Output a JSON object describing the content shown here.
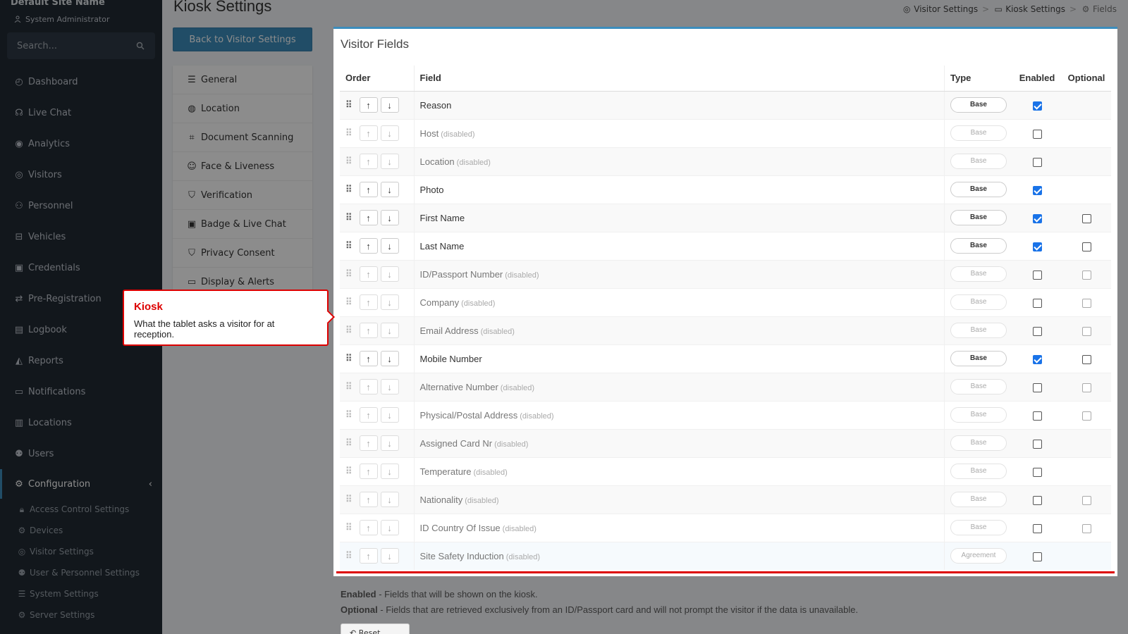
{
  "sidebar": {
    "site_name": "Default Site Name",
    "user_role": "System Administrator",
    "search_placeholder": "Search...",
    "items": [
      {
        "label": "Dashboard",
        "icon": "dashboard-icon"
      },
      {
        "label": "Live Chat",
        "icon": "headset-icon"
      },
      {
        "label": "Analytics",
        "icon": "analytics-icon"
      },
      {
        "label": "Visitors",
        "icon": "eye-icon"
      },
      {
        "label": "Personnel",
        "icon": "personnel-icon"
      },
      {
        "label": "Vehicles",
        "icon": "car-icon"
      },
      {
        "label": "Credentials",
        "icon": "badge-icon"
      },
      {
        "label": "Pre-Registration",
        "icon": "arrows-icon"
      },
      {
        "label": "Logbook",
        "icon": "book-icon"
      },
      {
        "label": "Reports",
        "icon": "reports-icon"
      },
      {
        "label": "Notifications",
        "icon": "chat-icon"
      },
      {
        "label": "Locations",
        "icon": "building-icon"
      },
      {
        "label": "Users",
        "icon": "users-icon"
      }
    ],
    "active_item": {
      "label": "Configuration",
      "icon": "gear-icon"
    },
    "sub_items": [
      {
        "label": "Access Control Settings",
        "icon": "lock-icon"
      },
      {
        "label": "Devices",
        "icon": "gear-icon"
      },
      {
        "label": "Visitor Settings",
        "icon": "eye-icon"
      },
      {
        "label": "User & Personnel Settings",
        "icon": "users-icon"
      },
      {
        "label": "System Settings",
        "icon": "sliders-icon"
      },
      {
        "label": "Server Settings",
        "icon": "server-icon"
      }
    ]
  },
  "header": {
    "title": "Kiosk Settings",
    "breadcrumb": [
      "Visitor Settings",
      "Kiosk Settings",
      "Fields"
    ]
  },
  "back_button": "Back to Visitor Settings",
  "settings_menu": [
    "General",
    "Location",
    "Document Scanning",
    "Face & Liveness",
    "Verification",
    "Badge & Live Chat",
    "Privacy Consent",
    "Display & Alerts"
  ],
  "panel": {
    "title": "Visitor Fields",
    "columns": {
      "order": "Order",
      "field": "Field",
      "type": "Type",
      "enabled": "Enabled",
      "optional": "Optional"
    },
    "disabled_note": "(disabled)",
    "rows": [
      {
        "field": "Reason",
        "disabled": false,
        "type": "Base",
        "enabled": true,
        "optional": null
      },
      {
        "field": "Host",
        "disabled": true,
        "type": "Base",
        "enabled": false,
        "optional": null
      },
      {
        "field": "Location",
        "disabled": true,
        "type": "Base",
        "enabled": false,
        "optional": null
      },
      {
        "field": "Photo",
        "disabled": false,
        "type": "Base",
        "enabled": true,
        "optional": null
      },
      {
        "field": "First Name",
        "disabled": false,
        "type": "Base",
        "enabled": true,
        "optional": false
      },
      {
        "field": "Last Name",
        "disabled": false,
        "type": "Base",
        "enabled": true,
        "optional": false
      },
      {
        "field": "ID/Passport Number",
        "disabled": true,
        "type": "Base",
        "enabled": false,
        "optional": false
      },
      {
        "field": "Company",
        "disabled": true,
        "type": "Base",
        "enabled": false,
        "optional": false
      },
      {
        "field": "Email Address",
        "disabled": true,
        "type": "Base",
        "enabled": false,
        "optional": false
      },
      {
        "field": "Mobile Number",
        "disabled": false,
        "type": "Base",
        "enabled": true,
        "optional": false
      },
      {
        "field": "Alternative Number",
        "disabled": true,
        "type": "Base",
        "enabled": false,
        "optional": false
      },
      {
        "field": "Physical/Postal Address",
        "disabled": true,
        "type": "Base",
        "enabled": false,
        "optional": false
      },
      {
        "field": "Assigned Card Nr",
        "disabled": true,
        "type": "Base",
        "enabled": false,
        "optional": null
      },
      {
        "field": "Temperature",
        "disabled": true,
        "type": "Base",
        "enabled": false,
        "optional": null
      },
      {
        "field": "Nationality",
        "disabled": true,
        "type": "Base",
        "enabled": false,
        "optional": false
      },
      {
        "field": "ID Country Of Issue",
        "disabled": true,
        "type": "Base",
        "enabled": false,
        "optional": false
      },
      {
        "field": "Site Safety Induction",
        "disabled": true,
        "type": "Agreement",
        "enabled": false,
        "optional": null
      }
    ]
  },
  "legend": {
    "enabled_label": "Enabled",
    "enabled_text": " - Fields that will be shown on the kiosk.",
    "optional_label": "Optional",
    "optional_text": " - Fields that are retrieved exclusively from an ID/Passport card and will not prompt the visitor if the data is unavailable."
  },
  "reset_button": "Reset order",
  "tooltip": {
    "title": "Kiosk",
    "body": "What the tablet asks a visitor for at reception."
  },
  "colors": {
    "accent": "#3c8dbc",
    "highlight": "#dd0000",
    "check": "#1a73e8",
    "sidebar": "#212a33"
  }
}
